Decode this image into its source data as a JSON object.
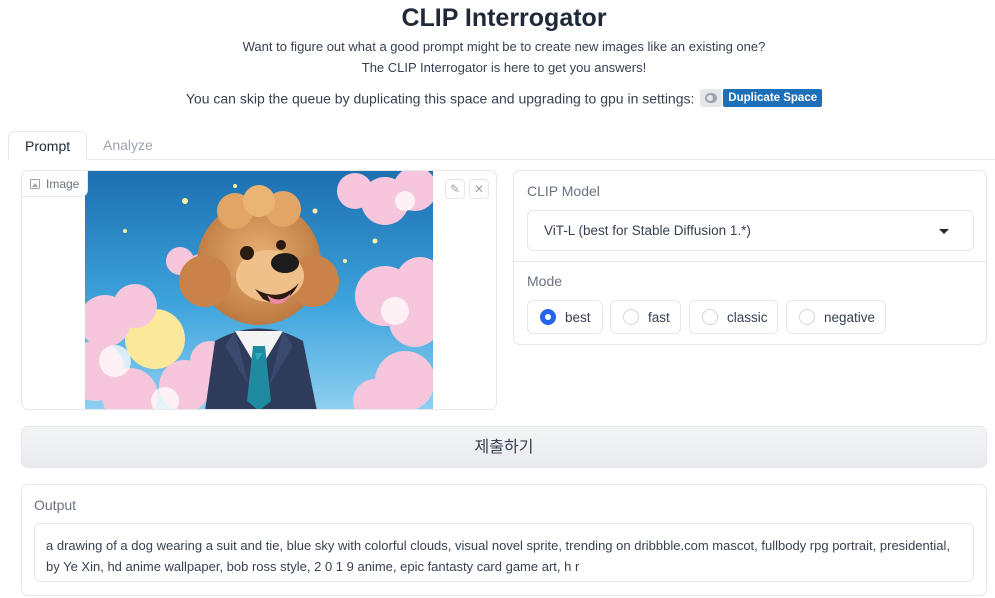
{
  "header": {
    "title": "CLIP Interrogator",
    "subtitle_line1": "Want to figure out what a good prompt might be to create new images like an existing one?",
    "subtitle_line2": "The CLIP Interrogator is here to get you answers!",
    "skip_text": "You can skip the queue by duplicating this space and upgrading to gpu in settings:",
    "duplicate_label": "Duplicate Space"
  },
  "tabs": [
    {
      "label": "Prompt",
      "active": true
    },
    {
      "label": "Analyze",
      "active": false
    }
  ],
  "image_input": {
    "label": "Image",
    "image_subject": "cartoon dog in suit and tie with pastel clouds",
    "edit_icon": "pencil-icon",
    "close_icon": "close-icon"
  },
  "clip_model": {
    "label": "CLIP Model",
    "selected": "ViT-L (best for Stable Diffusion 1.*)"
  },
  "mode": {
    "label": "Mode",
    "options": [
      "best",
      "fast",
      "classic",
      "negative"
    ],
    "selected": "best"
  },
  "submit_label": "제출하기",
  "output": {
    "label": "Output",
    "text": "a drawing of a dog wearing a suit and tie, blue sky with colorful clouds, visual novel sprite, trending on dribbble.com mascot, fullbody rpg portrait, presidential, by Ye Xin, hd anime wallpaper, bob ross style, 2 0 1 9 anime, epic fantasty card game art, h r"
  },
  "colors": {
    "accent_blue": "#2563eb",
    "duplicate_badge": "#1d6fb8"
  }
}
